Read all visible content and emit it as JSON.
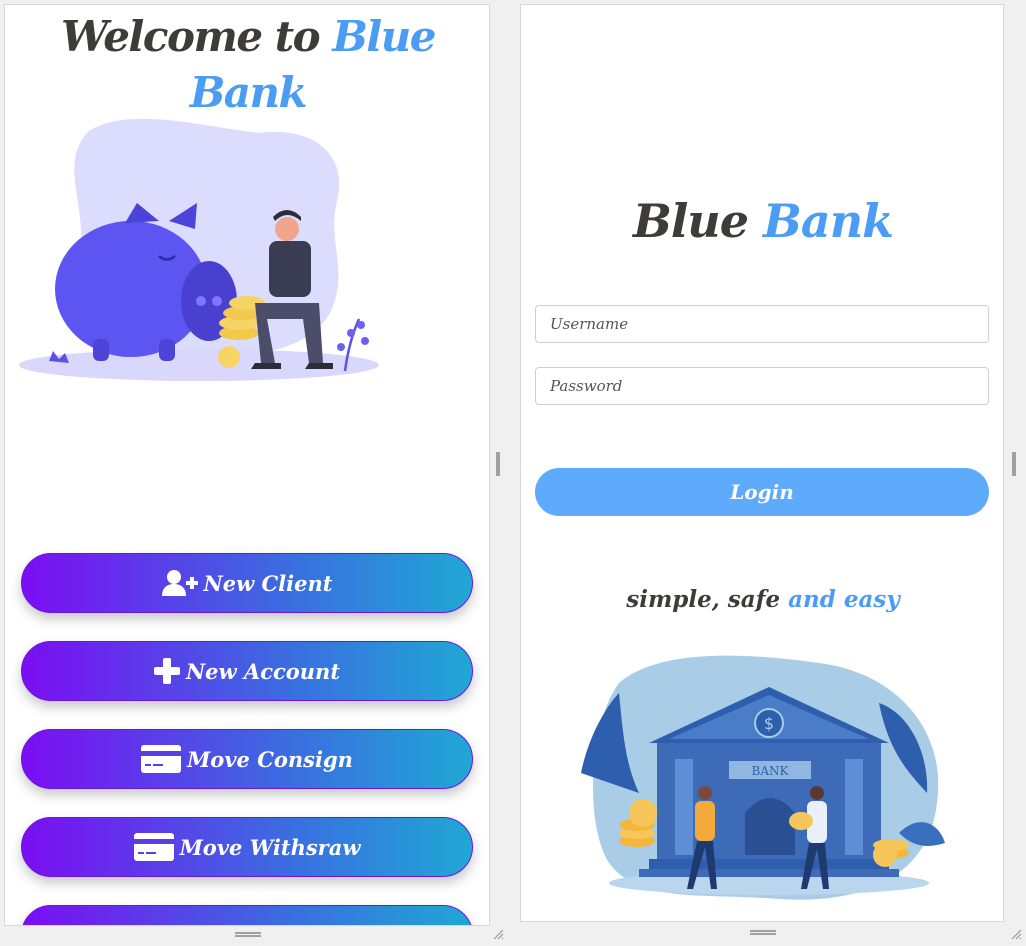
{
  "left_panel": {
    "welcome_prefix": "Welcome to",
    "welcome_brand": "Blue Bank",
    "buttons": [
      {
        "label": "New Client",
        "icon": "user-plus-icon"
      },
      {
        "label": "New Account",
        "icon": "plus-icon"
      },
      {
        "label": "Move Consign",
        "icon": "credit-card-icon"
      },
      {
        "label": "Move Withsraw",
        "icon": "credit-card-icon"
      }
    ]
  },
  "login_panel": {
    "brand_dark": "Blue",
    "brand_blue": "Bank",
    "username_placeholder": "Username",
    "password_placeholder": "Password",
    "login_label": "Login",
    "tagline_dark": "simple, safe",
    "tagline_blue": "and easy",
    "bank_sign": "BANK"
  },
  "colors": {
    "brand_blue": "#4a9cf5",
    "dark_text": "#3f3b3b",
    "login_button": "#5eaafc",
    "gradient_start": "#7b0df2",
    "gradient_end": "#1fa8d4"
  }
}
